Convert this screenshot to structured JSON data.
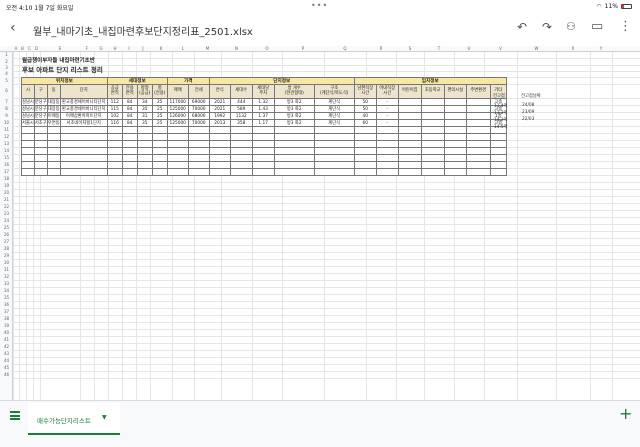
{
  "status": {
    "time": "오전 4:10",
    "date": "1월 7일 화요일",
    "battery": "11%"
  },
  "toolbar": {
    "file_title": "월부_내마기초_내집마련후보단지정리표_2501.xlsx"
  },
  "columns": [
    "A",
    "B",
    "C",
    "D",
    "E",
    "F",
    "G",
    "H",
    "I",
    "J",
    "K",
    "L",
    "M",
    "N",
    "O",
    "P",
    "Q",
    "R",
    "S",
    "T",
    "U",
    "V",
    "W",
    "X",
    "Y"
  ],
  "rows": [
    "1",
    "2",
    "3",
    "4",
    "5",
    "6",
    "7",
    "8",
    "9",
    "10",
    "11",
    "12",
    "13",
    "14",
    "15",
    "16",
    "17",
    "18",
    "19",
    "20",
    "21",
    "22",
    "23",
    "24",
    "25",
    "26",
    "27",
    "28",
    "29",
    "30",
    "31",
    "32",
    "33",
    "34",
    "35",
    "36",
    "37",
    "38",
    "39",
    "40",
    "41",
    "42",
    "43",
    "44",
    "45",
    "46"
  ],
  "sheet": {
    "title1": "월급쟁이부자들 내집마련기초반",
    "title2": "후보 아파트 단지 리스트 정리",
    "groups": {
      "location": "위치정보",
      "household": "세대정보",
      "price": "가격",
      "complex": "단지정보",
      "environment": "입지정보"
    },
    "headers": [
      "시",
      "구",
      "동",
      "단지",
      "공급\n면적",
      "전용\n면적",
      "평형\n(공급)",
      "평\n(전용)",
      "매매",
      "전세",
      "연식",
      "세대수",
      "세대당\n주차",
      "방 개수\n(현관형태)",
      "구조\n(계단식/복도식)",
      "남편직장\n시간",
      "아내직장\n시간",
      "어린이집",
      "초등학교",
      "편의시설",
      "주변환경",
      "기타"
    ],
    "rows": [
      [
        "성남시",
        "분당구",
        "대장동",
        "판교풍경채어바니티단지",
        "112",
        "84",
        "34",
        "25",
        "117000",
        "69000",
        "2021",
        "444",
        "1.32",
        "방3 화2",
        "계단식",
        "50",
        "-",
        "",
        "",
        "",
        "",
        "고층"
      ],
      [
        "성남시",
        "분당구",
        "대장동",
        "판교풍경채어바니티단지",
        "115",
        "84",
        "35",
        "25",
        "125000",
        "70000",
        "2021",
        "589",
        "1.43",
        "방3 화2",
        "계단식",
        "50",
        "-",
        "",
        "",
        "",
        "",
        "고층"
      ],
      [
        "성남시",
        "분당구",
        "이매동",
        "이매삼환아파트단지",
        "102",
        "84",
        "31",
        "25",
        "126000",
        "68000",
        "1992",
        "1132",
        "1.37",
        "방3 화2",
        "계단식",
        "40",
        "-",
        "",
        "",
        "",
        "",
        "1층"
      ],
      [
        "서울시",
        "서초구",
        "우면동",
        "서초네이처힐1단지",
        "116",
        "84",
        "35",
        "25",
        "125000",
        "70000",
        "2013",
        "358",
        "1.17",
        "방3 화2",
        "계단식",
        "60",
        "-",
        "",
        "",
        "",
        "",
        "고층"
      ]
    ],
    "side_header1": "전고점",
    "side_header2": "전고점날짜",
    "side_rows": [
      [
        "11.4억",
        "24/08"
      ],
      [
        "13.2억",
        "23/09"
      ],
      [
        "14.2억",
        "22/03"
      ],
      [
        "14.5억",
        ""
      ]
    ]
  },
  "bottom": {
    "sheet_tab": "매수가능단지리스트"
  }
}
